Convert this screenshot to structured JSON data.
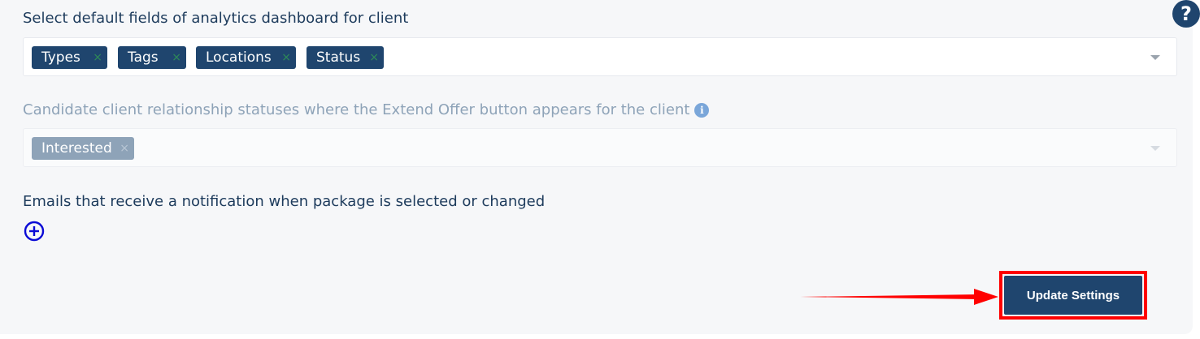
{
  "help": {
    "icon": "question-mark-icon",
    "glyph": "?"
  },
  "analytics_fields": {
    "label": "Select default fields of analytics dashboard for client",
    "chips": [
      {
        "label": "Types",
        "remove": "×"
      },
      {
        "label": "Tags",
        "remove": "×"
      },
      {
        "label": "Locations",
        "remove": "×"
      },
      {
        "label": "Status",
        "remove": "×"
      }
    ],
    "dropdown_icon": "caret-down-icon"
  },
  "extend_offer_statuses": {
    "label": "Candidate client relationship statuses where the Extend Offer button appears for the client",
    "info_icon": "info-icon",
    "info_glyph": "i",
    "disabled": true,
    "chips": [
      {
        "label": "Interested",
        "remove": "×"
      }
    ],
    "dropdown_icon": "caret-down-icon"
  },
  "notification_emails": {
    "label": "Emails that receive a notification when package is selected or changed",
    "add_icon": "plus-circle-icon"
  },
  "actions": {
    "update_label": "Update Settings"
  },
  "annotation": {
    "arrow_color": "#ff0000",
    "highlight_color": "#ff0000"
  },
  "colors": {
    "primary": "#1f456e",
    "label_text": "#1d3b5c",
    "disabled_text": "#8ea3b8",
    "add_icon": "#0b0bd6",
    "panel_bg": "#f6f7f9"
  }
}
